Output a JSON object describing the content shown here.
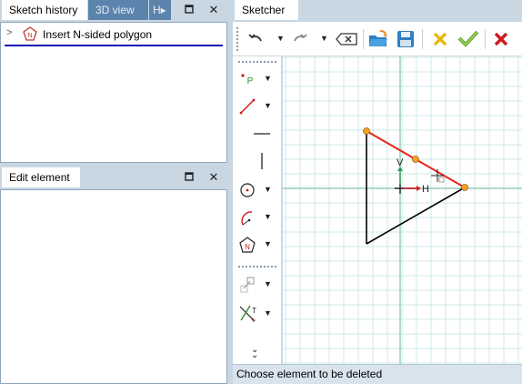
{
  "left_top": {
    "tabs": [
      {
        "label": "Sketch history",
        "active": true
      },
      {
        "label": "3D view",
        "active": false
      },
      {
        "label": "H",
        "active": false
      }
    ],
    "history_items": [
      {
        "label": "Insert N-sided polygon",
        "expanded": false,
        "icon": "polygon-n-icon"
      }
    ]
  },
  "left_bottom": {
    "tabs": [
      {
        "label": "Edit element",
        "active": true
      }
    ]
  },
  "sketcher": {
    "tab_label": "Sketcher",
    "toolbar": {
      "buttons": [
        "undo-icon",
        "redo-icon",
        "delete-backspace-icon",
        "open-folder-icon",
        "save-icon",
        "cancel-x-icon",
        "accept-check-icon",
        "close-x-icon"
      ]
    },
    "tools": [
      {
        "name": "point-tool",
        "glyph": "P"
      },
      {
        "name": "line-tool",
        "glyph": ""
      },
      {
        "name": "horizontal-line-tool",
        "glyph": ""
      },
      {
        "name": "vertical-line-tool",
        "glyph": ""
      },
      {
        "name": "circle-tool",
        "glyph": ""
      },
      {
        "name": "arc-tool",
        "glyph": ""
      },
      {
        "name": "polygon-tool",
        "glyph": "N"
      },
      {
        "name": "transform-tool",
        "glyph": ""
      },
      {
        "name": "trim-tool",
        "glyph": "T"
      }
    ],
    "canvas": {
      "axis_v_label": "V",
      "axis_h_label": "H",
      "colors": {
        "grid": "#cfe8e8",
        "axis": "#7fc4a8",
        "selected": "#e8201c",
        "vertex": "#f5a623",
        "triangle": "#000000"
      }
    },
    "status_text": "Choose element to be deleted"
  }
}
